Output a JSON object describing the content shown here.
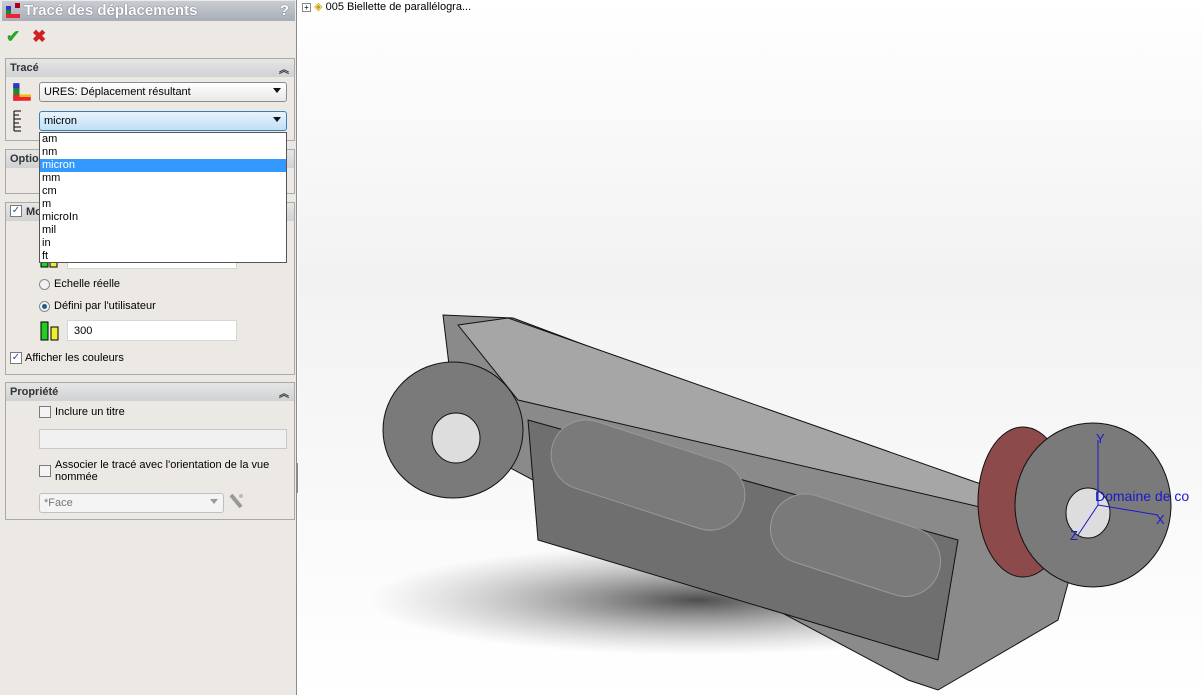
{
  "panel": {
    "title": "Tracé des déplacements",
    "help_label": "?",
    "ok_icon": "✔",
    "cancel_icon": "✖",
    "trace_group": {
      "title": "Tracé",
      "result_select": "URES: Déplacement résultant",
      "unit_select": "micron",
      "unit_options": [
        "am",
        "nm",
        "micron",
        "mm",
        "cm",
        "m",
        "microIn",
        "mil",
        "in",
        "ft"
      ],
      "selected_unit": "micron"
    },
    "options_group": {
      "title": "Optio"
    },
    "deform_group": {
      "title": "Mo",
      "checked": true,
      "radio_true_scale": "Echelle réelle",
      "radio_user": "Défini par l'utilisateur",
      "scale_value": "300",
      "show_colors": "Afficher les couleurs"
    },
    "property_group": {
      "title": "Propriété",
      "include_title": "Inclure un titre",
      "title_value": "",
      "assoc_view": "Associer le tracé avec l'orientation de la vue nommée",
      "view_select": "*Face"
    }
  },
  "tree": {
    "item": "005 Biellette de parallélogra..."
  },
  "viewport": {
    "axis_x": "X",
    "axis_y": "Y",
    "axis_z": "Z",
    "overlay_label": "Domaine de co"
  }
}
